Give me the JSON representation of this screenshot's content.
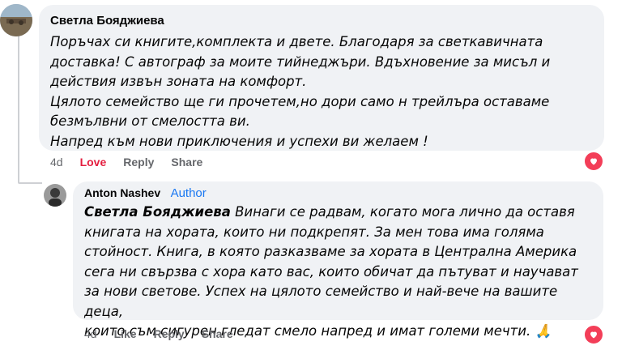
{
  "comment1": {
    "author": "Светла Бояджиева",
    "lines": [
      "Поръчах си книгите,комплекта и двете. Благодаря за светкавичната",
      "доставка! С автограф за моите тийнеджъри. Вдъхновение за мисъл и",
      "действия извън зоната на комфорт.",
      "Цялото семейство ще ги прочетем,но дори само н трейлъра оставаме",
      "безмълвни от смелостта ви.",
      "Напред към нови приключения и успехи ви желаем !"
    ],
    "actions": {
      "time": "4d",
      "like": "Love",
      "reply": "Reply",
      "share": "Share"
    },
    "reaction_icon": "heart-icon"
  },
  "comment2": {
    "author": "Anton Nashev",
    "badge": "Author",
    "mention": "Светла Бояджиева",
    "lines": [
      " Винаги се радвам, когато мога лично да оставя",
      "книгата на хората, които ни подкрепят. За мен това има голяма",
      "стойност. Книга, в която разказваме за хората в Централна Америка",
      "сега ни свързва с хора като вас, които обичат да пътуват и научават",
      "за нови светове. Успех на цялото семейство и най-вече на вашите деца,",
      "които съм сигурен гледат смело напред и имат големи мечти. 🙏"
    ],
    "actions": {
      "time": "4d",
      "like": "Like",
      "reply": "Reply",
      "share": "Share"
    },
    "reaction_icon": "heart-icon"
  },
  "colors": {
    "accent": "#1877f2",
    "love": "#e41e3f",
    "bubble": "#f0f2f5",
    "heart": "#f33e58"
  }
}
